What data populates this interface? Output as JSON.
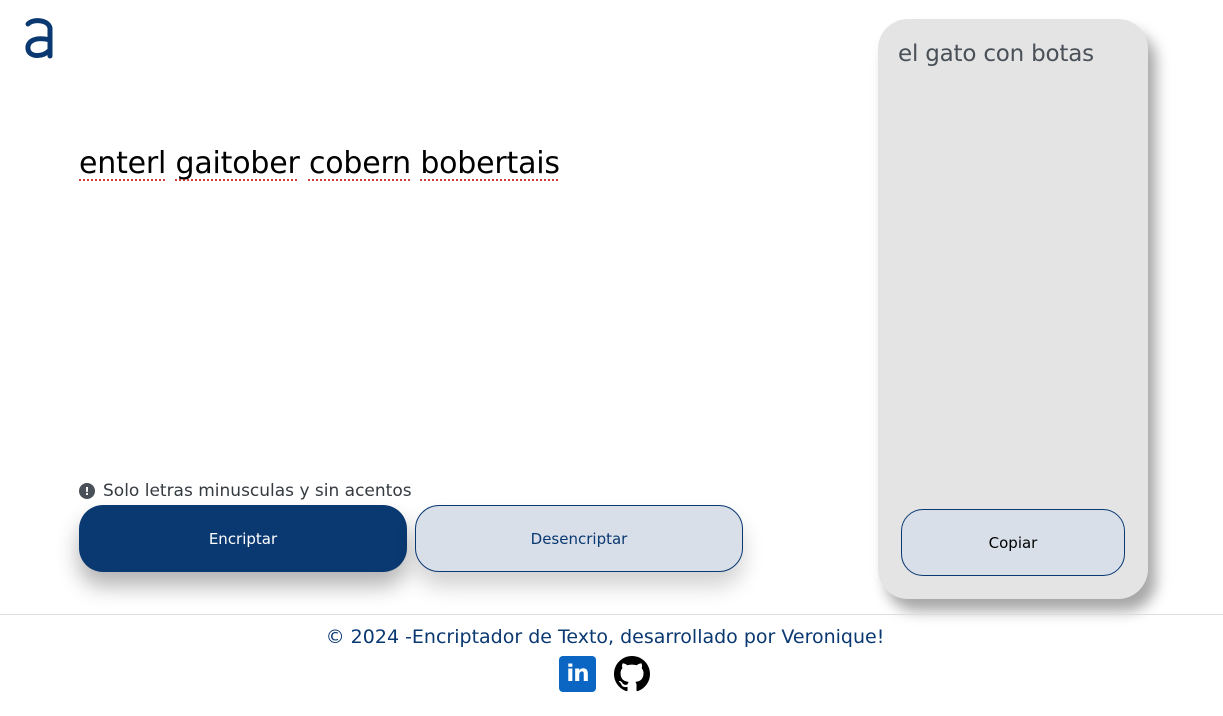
{
  "input": {
    "words": [
      "enterl",
      "gaitober",
      "cobern",
      "bobertais"
    ]
  },
  "hint": {
    "icon": "exclamation-circle-icon",
    "text": "Solo letras minusculas y sin acentos"
  },
  "buttons": {
    "encrypt_label": "Encriptar",
    "decrypt_label": "Desencriptar",
    "copy_label": "Copiar"
  },
  "output": {
    "text": "el gato con botas"
  },
  "footer": {
    "text": "© 2024 -Encriptador de Texto, desarrollado por Veronique!",
    "social": [
      {
        "icon": "linkedin-icon",
        "label": "in"
      },
      {
        "icon": "github-icon"
      }
    ]
  },
  "colors": {
    "primary": "#0a3871",
    "secondary": "#d8dfe8",
    "panel": "#e4e4e4",
    "linkedin": "#0a66c2"
  }
}
